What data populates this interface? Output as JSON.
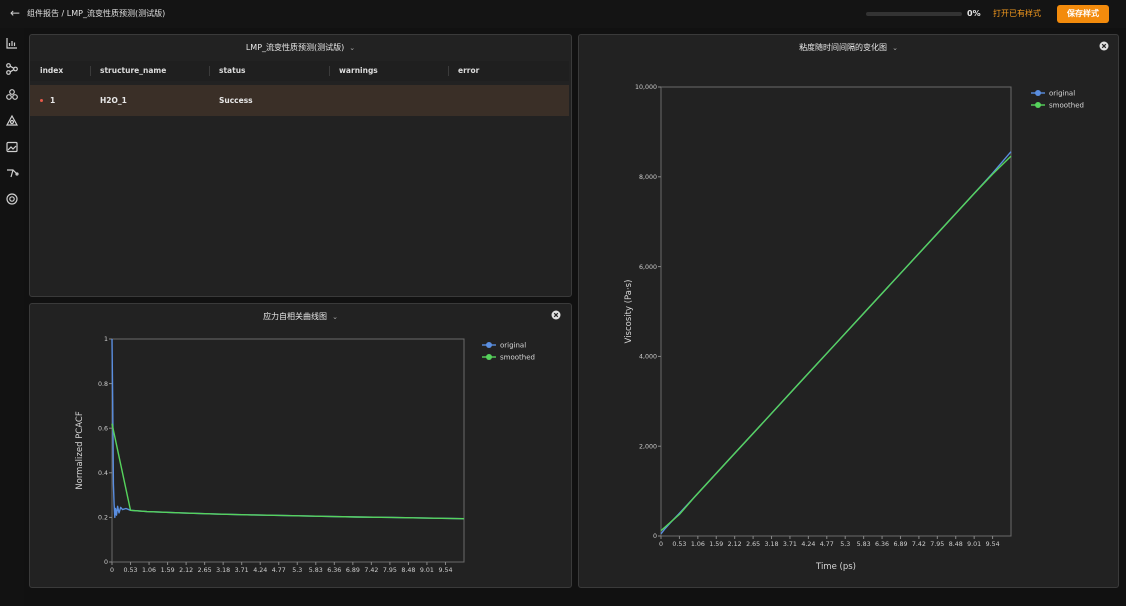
{
  "header": {
    "breadcrumb": "组件报告 / LMP_流变性质预测(测试版)",
    "progress_fraction": 0.0,
    "progress_text": "0%",
    "open_style_label": "打开已有样式",
    "save_style_label": "保存样式"
  },
  "sidebar": {
    "icons": [
      "bar-chart-icon",
      "flow-icon",
      "molecule-icon",
      "network-icon",
      "image-icon",
      "route-icon",
      "target-icon"
    ]
  },
  "table_panel": {
    "title": "LMP_流变性质预测(测试版)",
    "columns": [
      "index",
      "structure_name",
      "status",
      "warnings",
      "error"
    ],
    "rows": [
      {
        "index": "1",
        "structure_name": "H2O_1",
        "status": "Success",
        "warnings": "",
        "error": ""
      }
    ]
  },
  "colors": {
    "original": "#5a8ee0",
    "smoothed": "#56d35c",
    "accent": "#f38b0c"
  },
  "chart_data": [
    {
      "type": "line",
      "title": "应力自相关曲线图",
      "xlabel": "",
      "ylabel": "Normalized PCACF",
      "x_ticks": [
        "0",
        "0.53",
        "1.06",
        "1.59",
        "2.12",
        "2.65",
        "3.18",
        "3.71",
        "4.24",
        "4.77",
        "5.3",
        "5.83",
        "6.36",
        "6.89",
        "7.42",
        "7.95",
        "8.48",
        "9.01",
        "9.54"
      ],
      "y_ticks": [
        "0",
        "0.2",
        "0.4",
        "0.6",
        "0.8",
        "1"
      ],
      "xlim": [
        0,
        10.07
      ],
      "ylim": [
        0,
        1
      ],
      "legend": "top-right",
      "grid": false,
      "series": [
        {
          "name": "original",
          "x": [
            0,
            0.02,
            0.04,
            0.06,
            0.08,
            0.1,
            0.13,
            0.16,
            0.2,
            0.25,
            0.3,
            0.4,
            0.53,
            1.0,
            2.0,
            3.0,
            4.0,
            5.0,
            6.0,
            7.0,
            8.0,
            9.0,
            10.07
          ],
          "y": [
            1.0,
            0.72,
            0.35,
            0.26,
            0.2,
            0.24,
            0.21,
            0.25,
            0.22,
            0.245,
            0.235,
            0.24,
            0.232,
            0.226,
            0.22,
            0.215,
            0.211,
            0.208,
            0.205,
            0.202,
            0.2,
            0.197,
            0.194
          ]
        },
        {
          "name": "smoothed",
          "x": [
            0,
            0.53,
            1.0,
            2.0,
            3.0,
            4.0,
            5.0,
            6.0,
            7.0,
            8.0,
            9.0,
            10.07
          ],
          "y": [
            0.62,
            0.232,
            0.226,
            0.22,
            0.215,
            0.211,
            0.208,
            0.205,
            0.202,
            0.2,
            0.197,
            0.194
          ]
        }
      ]
    },
    {
      "type": "line",
      "title": "粘度随时间间隔的变化图",
      "xlabel": "Time (ps)",
      "ylabel": "Viscosity (Pa·s)",
      "x_ticks": [
        "0",
        "0.53",
        "1.06",
        "1.59",
        "2.12",
        "2.65",
        "3.18",
        "3.71",
        "4.24",
        "4.77",
        "5.3",
        "5.83",
        "6.36",
        "6.89",
        "7.42",
        "7.95",
        "8.48",
        "9.01",
        "9.54"
      ],
      "y_ticks": [
        "0",
        "2,000",
        "4,000",
        "6,000",
        "8,000",
        "10,000"
      ],
      "xlim": [
        0,
        10.07
      ],
      "ylim": [
        0,
        10000
      ],
      "legend": "top-right",
      "grid": false,
      "series": [
        {
          "name": "original",
          "x": [
            0,
            0.1,
            0.3,
            0.5,
            1.0,
            2.0,
            3.0,
            4.0,
            5.0,
            6.0,
            7.0,
            8.0,
            9.0,
            9.54,
            10.07
          ],
          "y": [
            50,
            150,
            320,
            480,
            900,
            1740,
            2580,
            3420,
            4260,
            5100,
            5940,
            6780,
            7620,
            8080,
            8560
          ]
        },
        {
          "name": "smoothed",
          "x": [
            0,
            0.53,
            1.0,
            2.0,
            3.0,
            4.0,
            5.0,
            6.0,
            7.0,
            8.0,
            9.0,
            9.54,
            10.07
          ],
          "y": [
            120,
            480,
            900,
            1740,
            2580,
            3420,
            4260,
            5100,
            5940,
            6780,
            7620,
            8060,
            8460
          ]
        }
      ]
    }
  ]
}
